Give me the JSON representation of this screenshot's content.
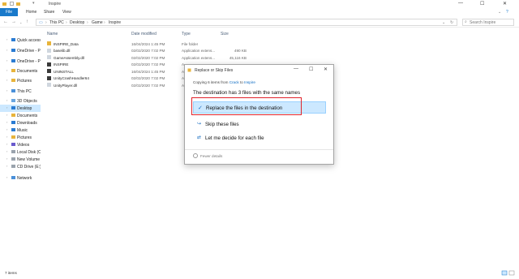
{
  "window": {
    "title": "Inspire",
    "controls": [
      "—",
      "☐",
      "✕"
    ]
  },
  "ribbon": {
    "tabs": [
      "File",
      "Home",
      "Share",
      "View"
    ]
  },
  "address": {
    "crumbs": [
      "This PC",
      "Desktop",
      "Game",
      "Inspire"
    ],
    "search_placeholder": "Search Inspire"
  },
  "nav": {
    "items": [
      {
        "label": "Quick access",
        "icon": "star-icon"
      },
      {
        "label": "OneDrive - Pers",
        "icon": "cloud-icon"
      },
      {
        "label": "OneDrive - Pers",
        "icon": "cloud-icon"
      },
      {
        "label": "Documents",
        "icon": "documents-icon"
      },
      {
        "label": "Pictures",
        "icon": "pictures-icon"
      },
      {
        "label": "This PC",
        "icon": "computer-icon"
      },
      {
        "label": "3D Objects",
        "icon": "cube-icon"
      },
      {
        "label": "Desktop",
        "icon": "desktop-icon",
        "selected": true
      },
      {
        "label": "Documents",
        "icon": "documents-icon"
      },
      {
        "label": "Downloads",
        "icon": "download-icon"
      },
      {
        "label": "Music",
        "icon": "music-icon"
      },
      {
        "label": "Pictures",
        "icon": "pictures-icon"
      },
      {
        "label": "Videos",
        "icon": "video-icon"
      },
      {
        "label": "Local Disk (C:)",
        "icon": "disk-icon"
      },
      {
        "label": "New Volume (D:)",
        "icon": "disk-icon"
      },
      {
        "label": "CD Drive (E:)",
        "icon": "cd-icon"
      },
      {
        "label": "Network",
        "icon": "network-icon"
      }
    ]
  },
  "columns": {
    "name": "Name",
    "date": "Date modified",
    "type": "Type",
    "size": "Size"
  },
  "files": [
    {
      "name": "INSPIRE_Data",
      "date": "16/04/2024 1:45 PM",
      "type": "File folder",
      "size": "",
      "icon": "folder-icon"
    },
    {
      "name": "baselib.dll",
      "date": "02/02/2020 7:02 PM",
      "type": "Application extens...",
      "size": "490 KB",
      "icon": "dll-icon"
    },
    {
      "name": "GameAssembly.dll",
      "date": "02/02/2020 7:02 PM",
      "type": "Application extens...",
      "size": "45,116 KB",
      "icon": "dll-icon"
    },
    {
      "name": "INSPIRE",
      "date": "02/02/2020 7:02 PM",
      "type": "A",
      "size": "",
      "icon": "app-icon"
    },
    {
      "name": "UNINSTALL",
      "date": "16/04/2024 1:45 PM",
      "type": "A",
      "size": "",
      "icon": "app-icon"
    },
    {
      "name": "UnityCrashHandler64",
      "date": "02/02/2020 7:02 PM",
      "type": "A",
      "size": "",
      "icon": "app-icon"
    },
    {
      "name": "UnityPlayer.dll",
      "date": "02/02/2020 7:02 PM",
      "type": "A",
      "size": "",
      "icon": "dll-icon"
    }
  ],
  "status": {
    "count": "7 items"
  },
  "dialog": {
    "title": "Replace or Skip Files",
    "copying_prefix": "Copying 6 items from",
    "source": "Crack",
    "to": "to",
    "destination": "Inspire",
    "heading": "The destination has 3 files with the same names",
    "options": {
      "replace": "Replace the files in the destination",
      "skip": "Skip these files",
      "decide": "Let me decide for each file"
    },
    "details": "Fewer details"
  },
  "colors": {
    "accent": "#1979ca",
    "selection": "#cce8ff",
    "highlight_box": "#e0232b"
  }
}
